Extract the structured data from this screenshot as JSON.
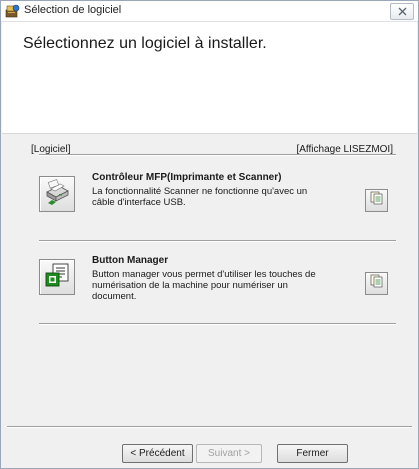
{
  "window": {
    "title": "Sélection de logiciel",
    "app_icon": "installer-icon",
    "close_icon": "close-icon"
  },
  "header": {
    "heading": "Sélectionnez un logiciel à installer."
  },
  "columns": {
    "left": "[Logiciel]",
    "right": "[Affichage LISEZMOI]"
  },
  "items": [
    {
      "title": "Contrôleur MFP(Imprimante et Scanner)",
      "description": "La fonctionnalité Scanner ne fonctionne qu'avec un câble d'interface USB.",
      "icon": "printer-scanner-icon",
      "readme_icon": "readme-document-icon"
    },
    {
      "title": "Button Manager",
      "description": "Button manager vous permet d'utiliser les touches de numérisation de la machine pour numériser un document.",
      "icon": "button-manager-icon",
      "readme_icon": "readme-document-icon"
    }
  ],
  "buttons": {
    "back": "< Précédent",
    "next": "Suivant >",
    "close": "Fermer"
  },
  "colors": {
    "window_bg": "#f0f0f0",
    "header_bg": "#ffffff",
    "disabled_text": "#a0a0a0"
  }
}
